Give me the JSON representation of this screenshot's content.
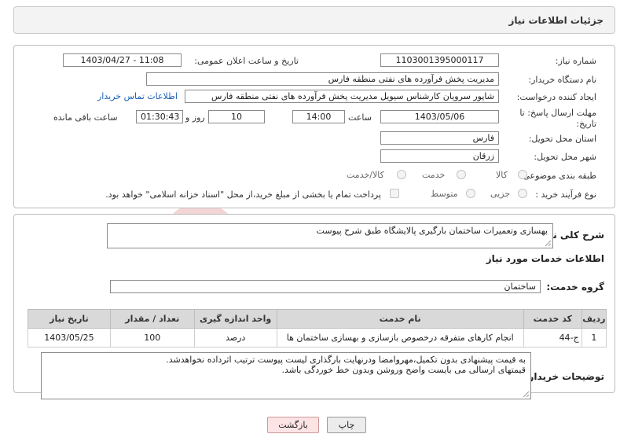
{
  "header": {
    "title": "جزئیات اطلاعات نیاز"
  },
  "form": {
    "need_number_label": "شماره نیاز:",
    "need_number": "1103001395000117",
    "announce_label": "تاریخ و ساعت اعلان عمومی:",
    "announce_value": "1403/04/27 - 11:08",
    "buyer_org_label": "نام دستگاه خریدار:",
    "buyer_org": "مدیریت پخش فرآورده های نفتی منطقه فارس",
    "requester_label": "ایجاد کننده درخواست:",
    "requester": "شاپور سرویان کارشناس سیویل مدیریت پخش فرآورده های نفتی منطقه فارس",
    "contact_link": "اطلاعات تماس خریدار",
    "deadline_label_1": "مهلت ارسال پاسخ: تا",
    "deadline_label_2": "تاریخ:",
    "deadline_date": "1403/05/06",
    "time_label": "ساعت",
    "deadline_time": "14:00",
    "days_value": "10",
    "days_label": "روز و",
    "remaining_time": "01:30:43",
    "remaining_label": "ساعت باقی مانده",
    "province_label": "استان محل تحویل:",
    "province": "فارس",
    "city_label": "شهر محل تحویل:",
    "city": "زرقان",
    "category_label": "طبقه بندی موضوعی:",
    "category_options": [
      "کالا",
      "خدمت",
      "کالا/خدمت"
    ],
    "process_label": "نوع فرآیند خرید :",
    "process_options": [
      "جزیی",
      "متوسط"
    ],
    "payment_note": "پرداخت تمام یا بخشی از مبلغ خرید،از محل \"اسناد خزانه اسلامی\" خواهد بود."
  },
  "summary": {
    "label": "شرح کلی نیاز:",
    "text": "بهسازی وتعمیرات ساختمان بارگیری پالایشگاه طبق شرح پیوست"
  },
  "services": {
    "section_title": "اطلاعات خدمات مورد نیاز",
    "group_label": "گروه خدمت:",
    "group_value": "ساختمان",
    "table": {
      "headers": [
        "ردیف",
        "کد خدمت",
        "نام خدمت",
        "واحد اندازه گیری",
        "تعداد / مقدار",
        "تاریخ نیاز"
      ],
      "rows": [
        [
          "1",
          "ج-44",
          "انجام کارهای متفرقه درخصوص بازسازی و بهسازی ساختمان ها",
          "درصد",
          "100",
          "1403/05/25"
        ]
      ]
    }
  },
  "buyer_notes": {
    "label": "توضیحات خریدار:",
    "line1": "به قیمت پیشنهادی بدون تکمیل،مهروامضا ودرنهایت بارگذاری لیست پیوست ترتیب اثرداده نخواهدشد.",
    "line2": "قیمتهای ارسالی می بایست واضح وروشن وبدون خط خوردگی باشد."
  },
  "buttons": {
    "print": "چاپ",
    "back": "بازگشت"
  },
  "colors": {
    "back_button_bg": "#fde4e4",
    "print_button_bg": "#ececec",
    "link": "#1a5fb4"
  }
}
